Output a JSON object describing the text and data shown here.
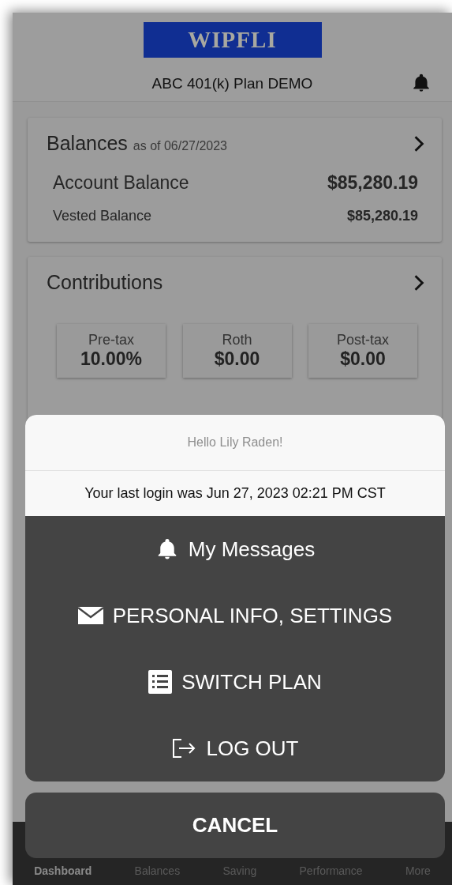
{
  "header": {
    "logo": "WIPFLI",
    "plan_title": "ABC 401(k) Plan DEMO"
  },
  "balances": {
    "title": "Balances",
    "as_of": "as of 06/27/2023",
    "rows": [
      {
        "label": "Account Balance",
        "value": "$85,280.19",
        "kind": "primary"
      },
      {
        "label": "Vested Balance",
        "value": "$85,280.19",
        "kind": "secondary"
      }
    ]
  },
  "contributions": {
    "title": "Contributions",
    "tiles": [
      {
        "label": "Pre-tax",
        "value": "10.00%"
      },
      {
        "label": "Roth",
        "value": "$0.00"
      },
      {
        "label": "Post-tax",
        "value": "$0.00"
      }
    ]
  },
  "action_sheet": {
    "greeting": "Hello Lily Raden!",
    "last_login": "Your last login was Jun 27, 2023 02:21 PM CST",
    "actions": [
      {
        "label": "My Messages",
        "kind": "bell"
      },
      {
        "label": "PERSONAL INFO, SETTINGS",
        "kind": "envelope"
      },
      {
        "label": "SWITCH PLAN",
        "kind": "list"
      },
      {
        "label": "LOG OUT",
        "kind": "logout"
      }
    ],
    "cancel": "CANCEL"
  },
  "tab_bar": [
    {
      "label": "Dashboard",
      "selected": true
    },
    {
      "label": "Balances",
      "selected": false
    },
    {
      "label": "Saving",
      "selected": false
    },
    {
      "label": "Performance",
      "selected": false
    },
    {
      "label": "More",
      "selected": false
    }
  ]
}
